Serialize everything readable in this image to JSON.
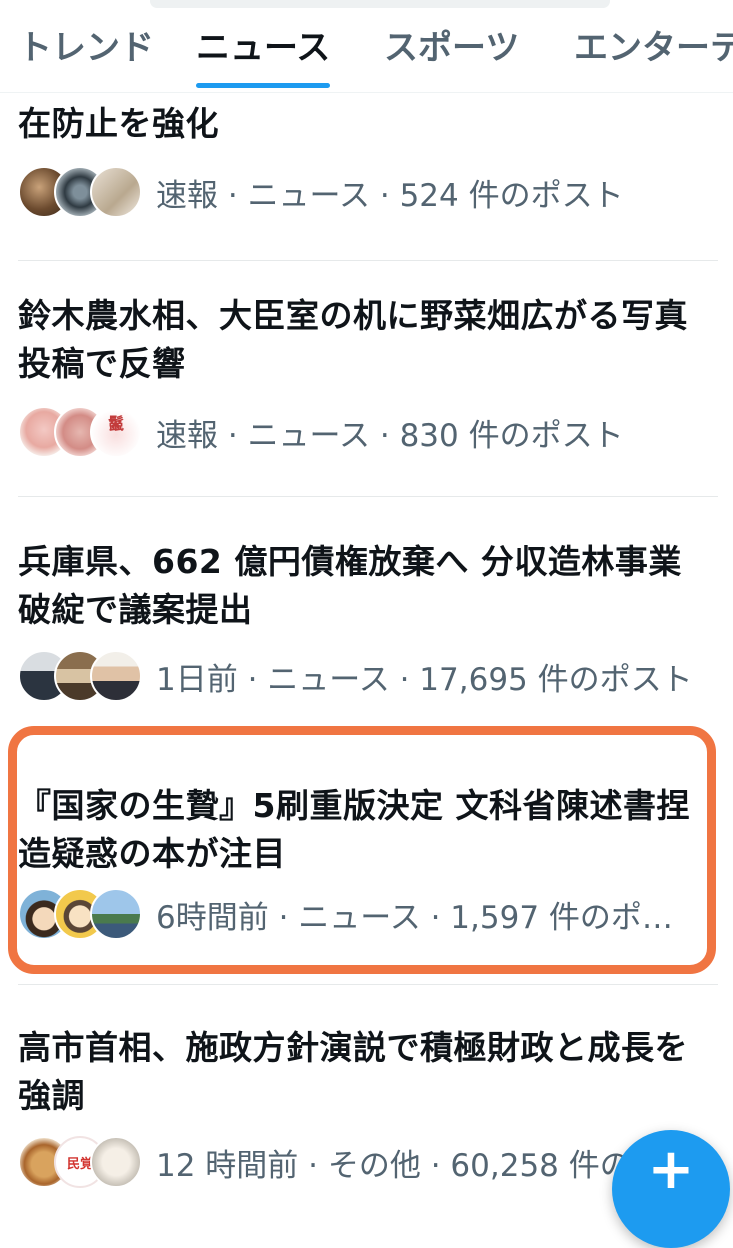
{
  "tabs": [
    {
      "label": "トレンド",
      "active": false
    },
    {
      "label": "ニュース",
      "active": true
    },
    {
      "label": "スポーツ",
      "active": false
    },
    {
      "label": "エンターテ",
      "active": false
    }
  ],
  "items": [
    {
      "title_partial": "在防止を強化",
      "meta": "速報 · ニュース · 524 件のポスト"
    },
    {
      "title": "鈴木農水相、大臣室の机に野菜畑広がる写真投稿で反響",
      "meta": "速報 · ニュース · 830 件のポスト"
    },
    {
      "title": "兵庫県、662 億円債権放棄へ 分収造林事業破綻で議案提出",
      "meta": "1日前 · ニュース · 17,695 件のポスト"
    },
    {
      "title": "『国家の生贄』5刷重版決定 文科省陳述書捏造疑惑の本が注目",
      "meta": "6時間前 · ニュース · 1,597 件のポ…"
    },
    {
      "title": "高市首相、施政方針演説で積極財政と成長を強調",
      "meta": "12 時間前 · その他 · 60,258 件のポ"
    }
  ],
  "avatar_badges": {
    "item2_badge": "鬣",
    "item5_badge": "民覚"
  },
  "colors": {
    "accent": "#1d9bf0",
    "highlight": "#f07542",
    "meta_text": "#536471"
  },
  "fab": {
    "icon": "plus-icon",
    "symbol": "+"
  }
}
